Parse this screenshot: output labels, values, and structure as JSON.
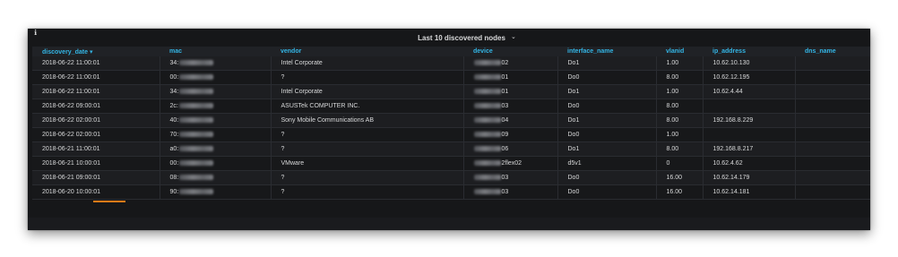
{
  "panel": {
    "title": "Last 10 discovered nodes",
    "corner_icon": "info-icon",
    "title_caret": "dropdown-caret-icon",
    "sort_arrow": "▾"
  },
  "table": {
    "columns": [
      "discovery_date",
      "mac",
      "vendor",
      "device",
      "interface_name",
      "vlanid",
      "ip_address",
      "dns_name"
    ],
    "sorted_column": "discovery_date",
    "rows": [
      {
        "discovery_date": "2018-06-22 11:00:01",
        "mac": "34:",
        "vendor": "Intel Corporate",
        "device": "02",
        "interface_name": "Do1",
        "vlanid": "1.00",
        "ip_address": "10.62.10.130",
        "dns_name": ""
      },
      {
        "discovery_date": "2018-06-22 11:00:01",
        "mac": "00:",
        "vendor": "?",
        "device": "01",
        "interface_name": "Do0",
        "vlanid": "8.00",
        "ip_address": "10.62.12.195",
        "dns_name": ""
      },
      {
        "discovery_date": "2018-06-22 11:00:01",
        "mac": "34:",
        "vendor": "Intel Corporate",
        "device": "01",
        "interface_name": "Do1",
        "vlanid": "1.00",
        "ip_address": "10.62.4.44",
        "dns_name": ""
      },
      {
        "discovery_date": "2018-06-22 09:00:01",
        "mac": "2c:",
        "vendor": "ASUSTek COMPUTER INC.",
        "device": "03",
        "interface_name": "Do0",
        "vlanid": "8.00",
        "ip_address": "",
        "dns_name": ""
      },
      {
        "discovery_date": "2018-06-22 02:00:01",
        "mac": "40:",
        "vendor": "Sony Mobile Communications AB",
        "device": "04",
        "interface_name": "Do1",
        "vlanid": "8.00",
        "ip_address": "192.168.8.229",
        "dns_name": ""
      },
      {
        "discovery_date": "2018-06-22 02:00:01",
        "mac": "70:",
        "vendor": "?",
        "device": "09",
        "interface_name": "Do0",
        "vlanid": "1.00",
        "ip_address": "",
        "dns_name": ""
      },
      {
        "discovery_date": "2018-06-21 11:00:01",
        "mac": "a0:",
        "vendor": "?",
        "device": "06",
        "interface_name": "Do1",
        "vlanid": "8.00",
        "ip_address": "192.168.8.217",
        "dns_name": ""
      },
      {
        "discovery_date": "2018-06-21 10:00:01",
        "mac": "00:",
        "vendor": "VMware",
        "device": "2flex02",
        "interface_name": "d5v1",
        "vlanid": "0",
        "ip_address": "10.62.4.62",
        "dns_name": ""
      },
      {
        "discovery_date": "2018-06-21 09:00:01",
        "mac": "08:",
        "vendor": "?",
        "device": "03",
        "interface_name": "Do0",
        "vlanid": "16.00",
        "ip_address": "10.62.14.179",
        "dns_name": ""
      },
      {
        "discovery_date": "2018-06-20 10:00:01",
        "mac": "90:",
        "vendor": "?",
        "device": "03",
        "interface_name": "Do0",
        "vlanid": "16.00",
        "ip_address": "10.62.14.181",
        "dns_name": ""
      }
    ]
  },
  "colors": {
    "panel_bg": "#161719",
    "header_text": "#33b5e5",
    "cell_text": "#d8d9da",
    "accent": "#eb7b18"
  }
}
